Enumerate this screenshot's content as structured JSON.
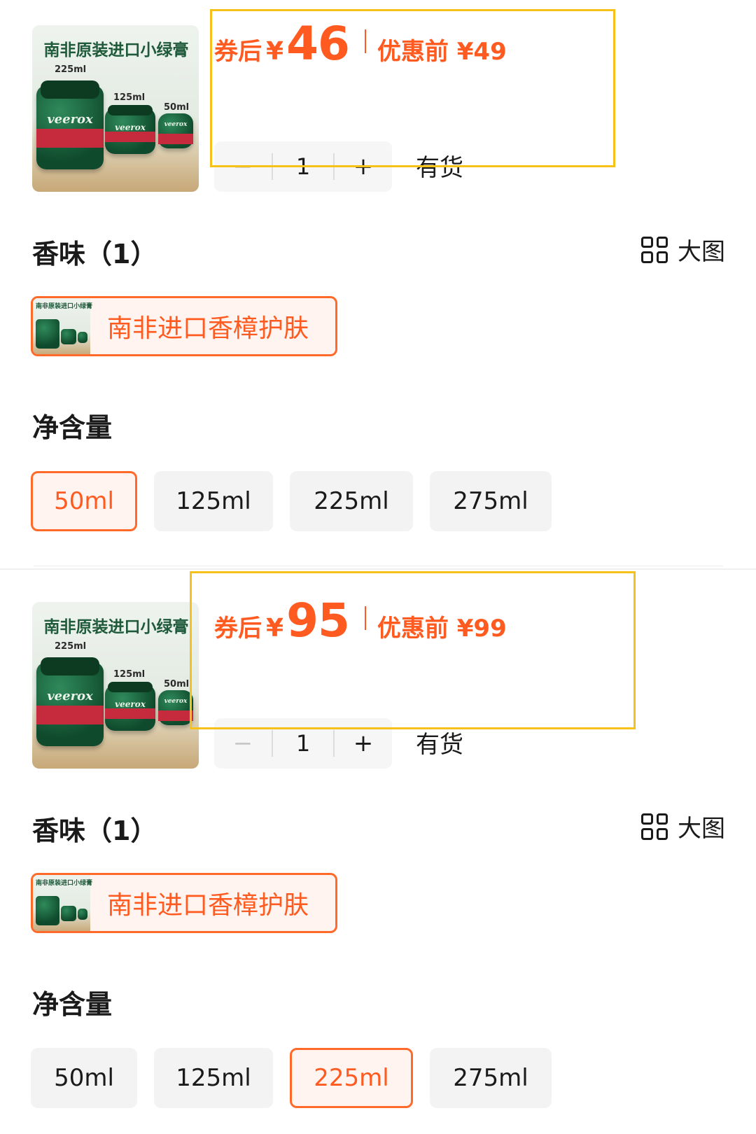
{
  "products": [
    {
      "thumb": {
        "title": "南非原装进口小绿膏",
        "sizes": [
          "225ml",
          "125ml",
          "50ml"
        ],
        "brand": "veerox"
      },
      "price": {
        "after_label": "券后",
        "currency": "¥",
        "after_value": "46",
        "before_text": "优惠前 ¥49"
      },
      "stepper": {
        "minus": "−",
        "quantity": "1",
        "plus": "+"
      },
      "stock_text": "有货",
      "flavor": {
        "title": "香味（1）",
        "big_picture_label": "大图",
        "options": [
          {
            "label": "南非进口香樟护肤",
            "selected": true
          }
        ]
      },
      "net_content": {
        "title": "净含量",
        "options": [
          {
            "label": "50ml",
            "selected": true
          },
          {
            "label": "125ml",
            "selected": false
          },
          {
            "label": "225ml",
            "selected": false
          },
          {
            "label": "275ml",
            "selected": false
          }
        ]
      }
    },
    {
      "thumb": {
        "title": "南非原装进口小绿膏",
        "sizes": [
          "225ml",
          "125ml",
          "50ml"
        ],
        "brand": "veerox"
      },
      "price": {
        "after_label": "券后",
        "currency": "¥",
        "after_value": "95",
        "before_text": "优惠前 ¥99"
      },
      "stepper": {
        "minus": "−",
        "quantity": "1",
        "plus": "+"
      },
      "stock_text": "有货",
      "flavor": {
        "title": "香味（1）",
        "big_picture_label": "大图",
        "options": [
          {
            "label": "南非进口香樟护肤",
            "selected": true
          }
        ]
      },
      "net_content": {
        "title": "净含量",
        "options": [
          {
            "label": "50ml",
            "selected": false
          },
          {
            "label": "125ml",
            "selected": false
          },
          {
            "label": "225ml",
            "selected": true
          },
          {
            "label": "275ml",
            "selected": false
          }
        ]
      }
    }
  ],
  "colors": {
    "accent": "#ff5a1f",
    "chip_border_selected": "#ff6a2a",
    "highlight_box": "#f6c21a",
    "chip_bg": "#f3f3f3"
  }
}
